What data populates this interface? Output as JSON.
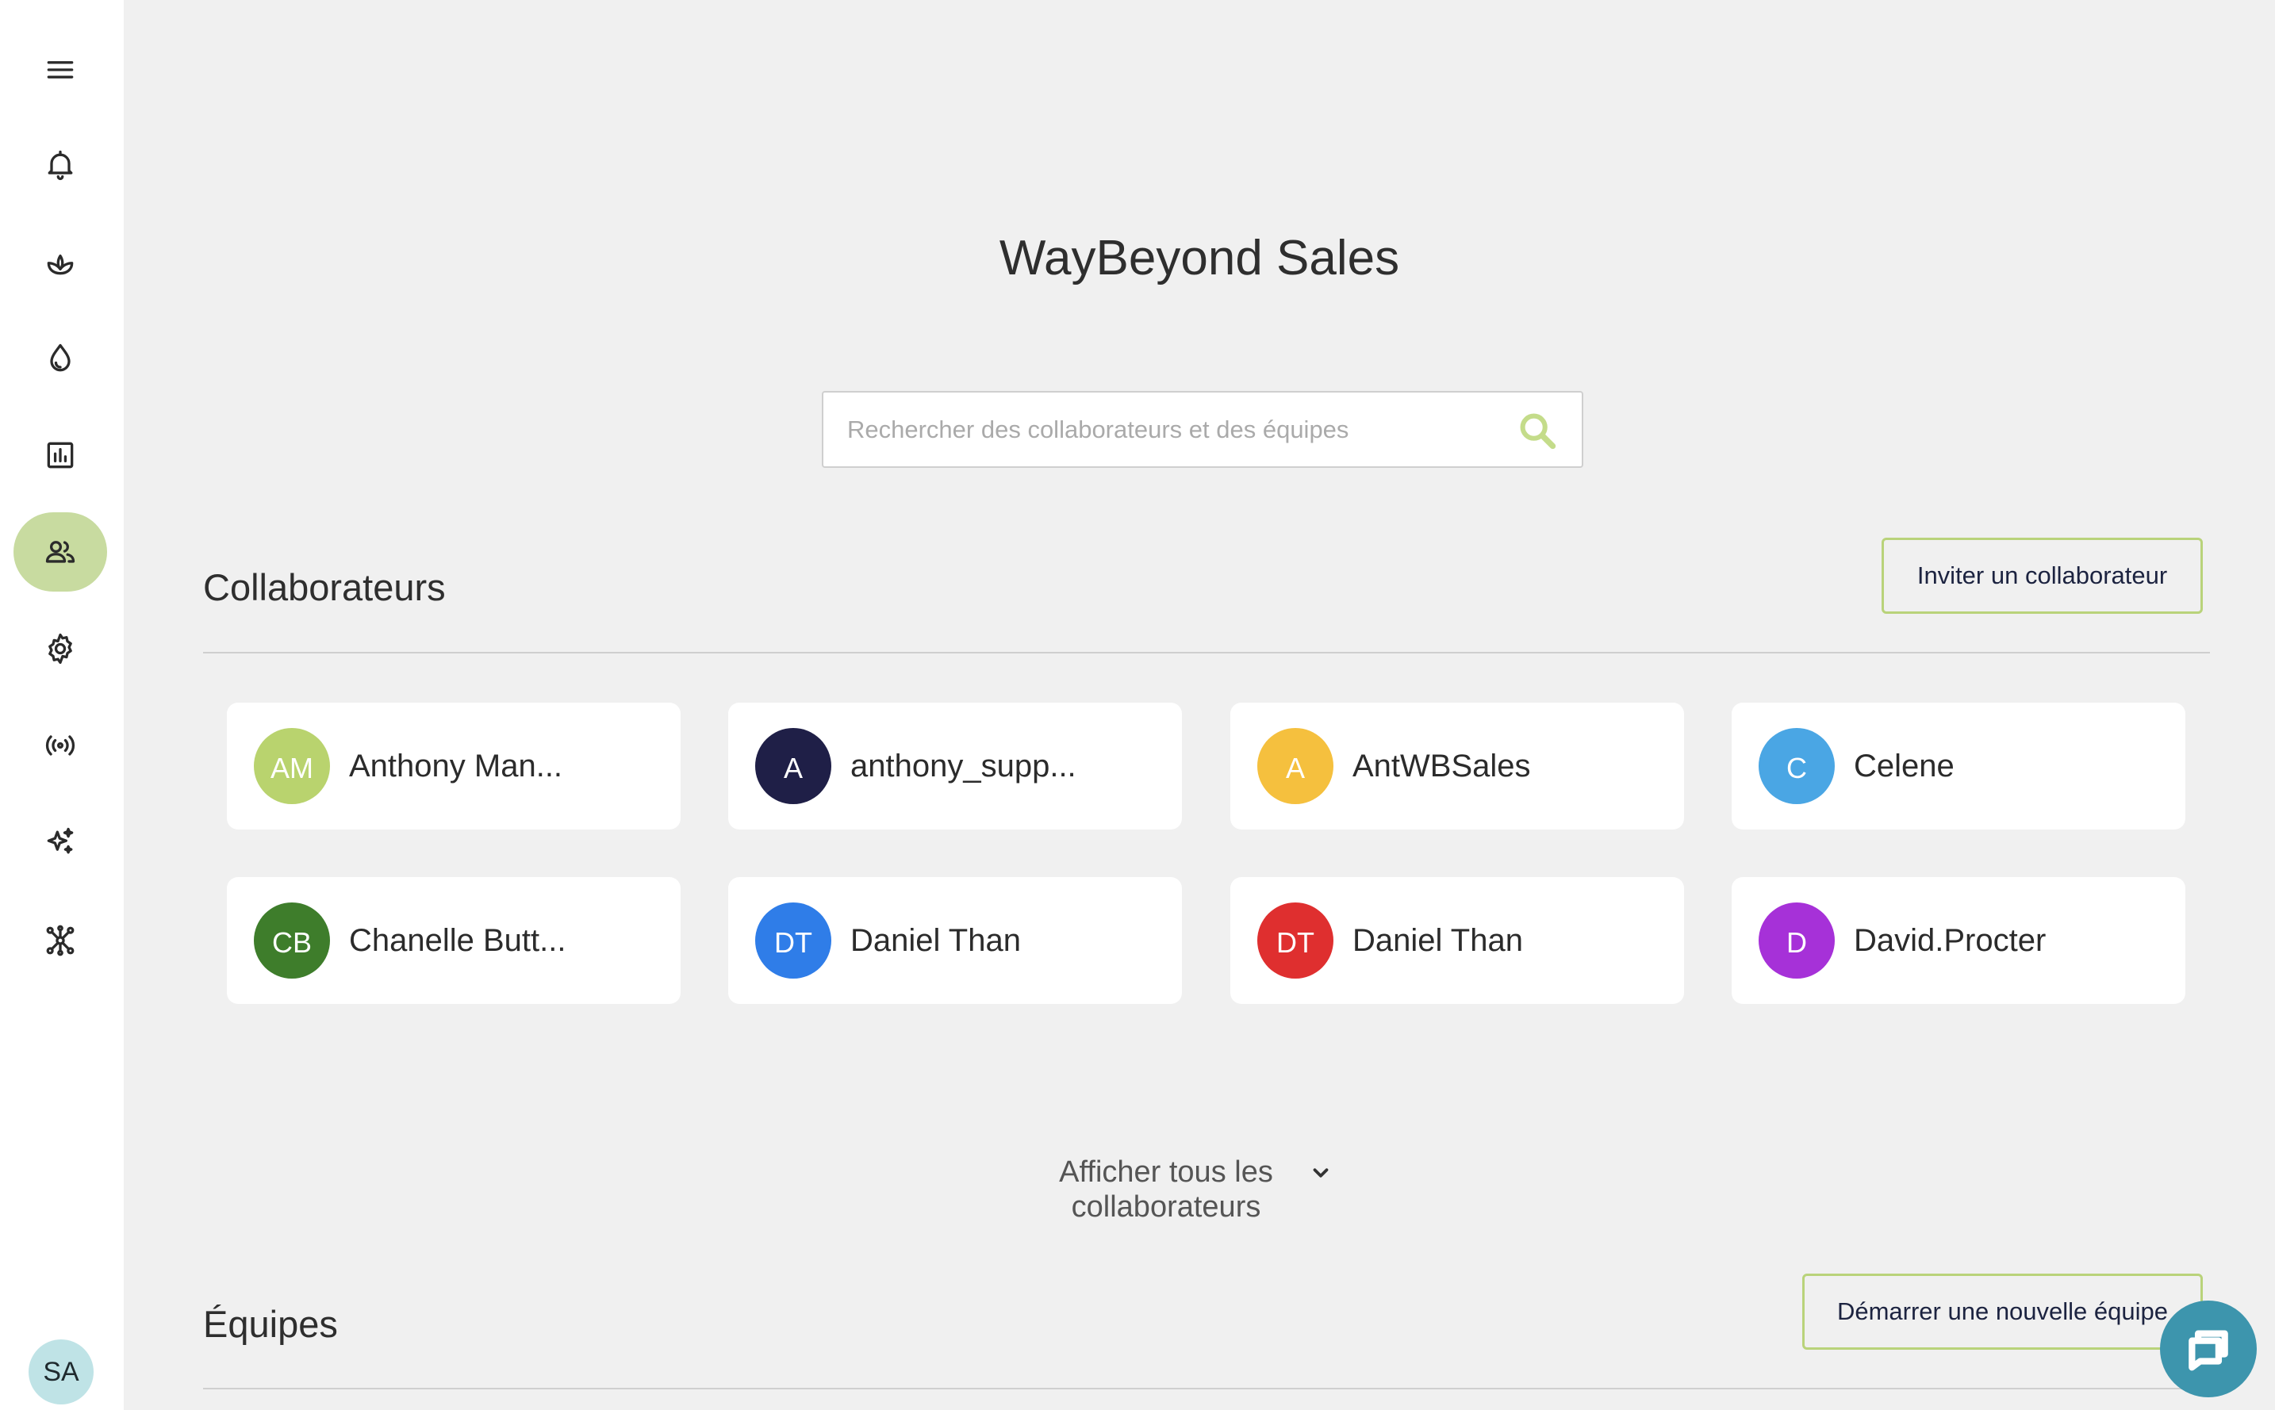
{
  "sidebar": {
    "items": [
      {
        "name": "menu-icon",
        "active": false
      },
      {
        "name": "bell-icon",
        "active": false
      },
      {
        "name": "plant-icon",
        "active": false
      },
      {
        "name": "drop-icon",
        "active": false
      },
      {
        "name": "chart-icon",
        "active": false
      },
      {
        "name": "users-icon",
        "active": true
      },
      {
        "name": "gear-icon",
        "active": false
      },
      {
        "name": "broadcast-icon",
        "active": false
      },
      {
        "name": "sparkles-icon",
        "active": false
      },
      {
        "name": "network-icon",
        "active": false
      }
    ],
    "user_initials": "SA"
  },
  "header": {
    "title": "WayBeyond Sales"
  },
  "search": {
    "placeholder": "Rechercher des collaborateurs et des équipes",
    "value": ""
  },
  "collaborators": {
    "title": "Collaborateurs",
    "invite_label": "Inviter un collaborateur",
    "show_all_label": "Afficher tous les collaborateurs",
    "items": [
      {
        "initials": "AM",
        "name": "Anthony Man...",
        "color": "#b9d36e"
      },
      {
        "initials": "A",
        "name": "anthony_supp...",
        "color": "#1f1f47"
      },
      {
        "initials": "A",
        "name": "AntWBSales",
        "color": "#f5c03e"
      },
      {
        "initials": "C",
        "name": "Celene",
        "color": "#4aa6e4"
      },
      {
        "initials": "CB",
        "name": "Chanelle Butt...",
        "color": "#3e7d2b"
      },
      {
        "initials": "DT",
        "name": "Daniel Than",
        "color": "#2f7de8"
      },
      {
        "initials": "DT",
        "name": "Daniel Than",
        "color": "#df2f2f"
      },
      {
        "initials": "D",
        "name": "David.Procter",
        "color": "#a631d8"
      }
    ]
  },
  "teams": {
    "title": "Équipes",
    "new_team_label": "Démarrer une nouvelle équipe"
  },
  "colors": {
    "accent": "#b9d37a",
    "active_nav": "#c8dba0",
    "chat_button": "#3d95ad"
  }
}
